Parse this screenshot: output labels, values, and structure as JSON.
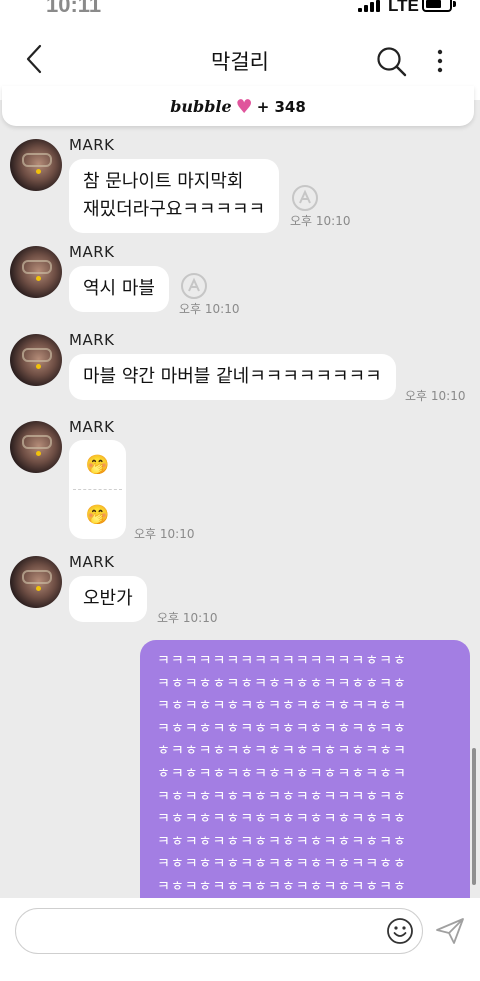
{
  "status_bar": {
    "time": "10:11",
    "network": "LTE"
  },
  "header": {
    "title": "막걸리"
  },
  "bubble_bar": {
    "brand": "bubble",
    "heart": "♥",
    "count": "+ 348"
  },
  "messages": [
    {
      "sender": "MARK",
      "lines": [
        "참 문나이트 마지막회",
        "재밌더라구요ㅋㅋㅋㅋㅋ"
      ],
      "time": "오후 10:10",
      "reaction": true
    },
    {
      "sender": "MARK",
      "lines": [
        "역시 마블"
      ],
      "time": "오후 10:10",
      "reaction": true
    },
    {
      "sender": "MARK",
      "lines": [
        "마블 약간 마버블 같네ㅋㅋㅋㅋㅋㅋㅋㅋ"
      ],
      "time": "오후 10:10"
    },
    {
      "sender": "MARK",
      "emojis": [
        "🤭",
        "🤭"
      ],
      "time": "오후 10:10"
    },
    {
      "sender": "MARK",
      "lines": [
        "오반가"
      ],
      "time": "오후 10:10"
    }
  ],
  "my_message": {
    "lines": [
      "ㅋㅋㅋㅋㅋㅋㅋㅋㅋㅋㅋㅋㅋㅋㅋㅎㅋㅎ",
      "ㅋㅎㅋㅎㅎㅋㅎㅋㅎㅋㅎㅎㅋㅋㅎㅎㅋㅎ",
      "ㅋㅎㅋㅎㅋㅎㅋㅎㅋㅎㅋㅎㅋㅎㅋㅋㅎㅋ",
      "ㅋㅎㅋㅎㅋㅎㅋㅎㅋㅎㅋㅎㅋㅎㅋㅎㅋㅎ",
      "ㅎㅋㅎㅋㅎㅋㅎㅋㅎㅋㅎㅋㅎㅋㅎㅋㅎㅋ",
      "ㅎㅋㅎㅋㅎㅋㅎㅋㅎㅋㅎㅋㅎㅋㅎㅋㅎㅋ",
      "ㅋㅎㅋㅎㅋㅎㅋㅎㅋㅎㅋㅎㅋㅋㅋㅎㅋㅎ",
      "ㅋㅎㅋㅎㅋㅎㅋㅎㅋㅎㅋㅎㅋㅎㅋㅎㅋㅎ",
      "ㅋㅎㅋㅎㅋㅎㅋㅎㅋㅎㅋㅎㅋㅎㅋㅎㅋㅎ",
      "ㅋㅎㅋㅎㅋㅎㅋㅎㅋㅎㅋㅎㅋㅎㅋㅋㅎㅎ",
      "ㅋㅎㅋㅎㅋㅎㅋㅎㅋㅎㅋㅎㅋㅎㅋㅎㅋㅎ"
    ]
  },
  "composer": {
    "placeholder": "",
    "value": ""
  },
  "colors": {
    "my_bubble": "#a37ee3",
    "background": "#ebebeb",
    "heart": "#e0559c"
  },
  "icons": {
    "back": "chevron-left-icon",
    "search": "search-icon",
    "more": "more-vertical-icon",
    "reaction": "translate-icon",
    "emoji": "smile-icon",
    "send": "send-icon"
  }
}
